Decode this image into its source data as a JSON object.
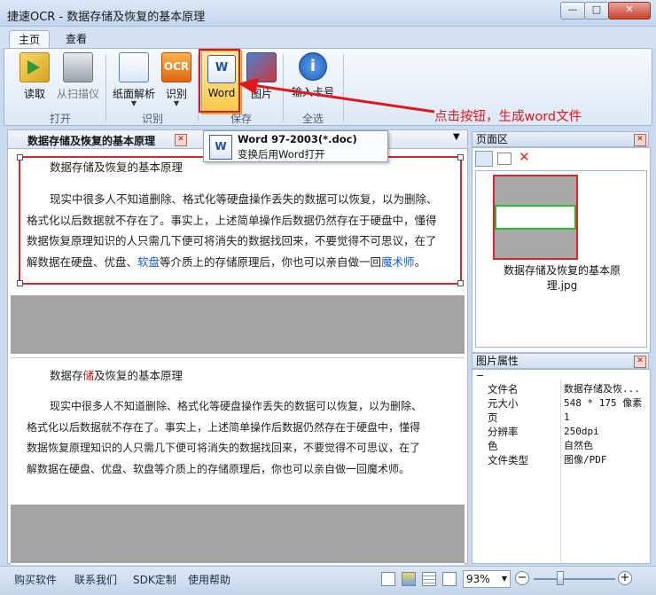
{
  "window": {
    "title": "捷速OCR - 数据存储及恢复的基本原理"
  },
  "tabs": [
    {
      "label": "主页"
    },
    {
      "label": "查看"
    }
  ],
  "ribbon": {
    "open": {
      "read": "读取",
      "scan": "从扫描仪",
      "group": "打开"
    },
    "recognize": {
      "layout": "纸面解析",
      "ocr": "识别",
      "group": "识别"
    },
    "save": {
      "word": "Word",
      "picture": "图片",
      "group": "保存"
    },
    "select_all": {
      "enter_all": "输入卡号",
      "group": "全选"
    }
  },
  "annotation": "点击按钮，生成word文件",
  "tooltip": {
    "title": "Word 97-2003(*.doc)",
    "desc": "变换后用Word打开"
  },
  "document": {
    "tab_title": "数据存储及恢复的基本原理",
    "heading": "数据存储及恢复的基本原理",
    "p1": "现实中很多人不知道删除、格式化等硬盘操作丢失的数据可以恢复，以为删除、",
    "p2": "格式化以后数据就不存在了。事实上，上述简单操作后数据仍然存在于硬盘中，懂得",
    "p3": "数据恢复原理知识的人只需几下便可将消失的数据找回来，不要觉得不可思议，在了",
    "p4a": "解数据在硬盘、优盘、",
    "p4b": "软盘",
    "p4c": "等介质上的存储原理后，你也可以亲自做一回",
    "p4d": "魔术师",
    "p4e": "。"
  },
  "result": {
    "heading_a": "数据存",
    "heading_b": "储",
    "heading_c": "及恢复的基本原理",
    "r1": "现实中很多人不知道删除、格式化等硬盘操作丢失的数据可以恢复，以为删除、",
    "r2": "格式化以后数据就不存在了。事实上，上述简单操作后数据仍然存在于硬盘中，懂得",
    "r3": "数据恢复原理知识的人只需几下便可将消失的数据找回来，不要觉得不可思议，在了",
    "r4": "解数据在硬盘、优盘、软盘等介质上的存储原理后，你也可以亲自做一回魔术师。"
  },
  "page_area": {
    "title": "页面区",
    "thumb_caption_1": "数据存储及恢复的基本原",
    "thumb_caption_2": "理.jpg"
  },
  "properties": {
    "title": "图片属性",
    "rows": [
      {
        "k": "文件名",
        "v": "数据存储及恢..."
      },
      {
        "k": "元大小",
        "v": "548 * 175 像素"
      },
      {
        "k": "页",
        "v": "1"
      },
      {
        "k": "分辨率",
        "v": "250dpi"
      },
      {
        "k": "色",
        "v": "自然色"
      },
      {
        "k": "文件类型",
        "v": "图像/PDF"
      }
    ]
  },
  "status": {
    "buy": "购买软件",
    "contact": "联系我们",
    "sdk": "SDK定制",
    "help": "使用帮助",
    "zoom": "93%"
  },
  "colors": {
    "annotation": "#e2161d",
    "highlight_box": "#d8262e",
    "link_blue": "#1660c8"
  }
}
